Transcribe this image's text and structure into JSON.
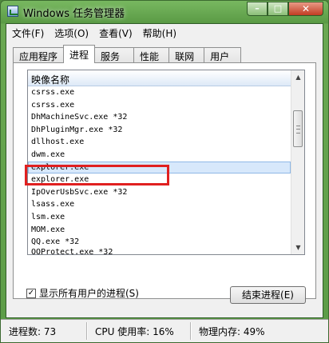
{
  "window": {
    "title": "Windows 任务管理器",
    "buttons": {
      "minimize": "–",
      "maximize": "□",
      "close": "✕"
    }
  },
  "menu": [
    "文件(F)",
    "选项(O)",
    "查看(V)",
    "帮助(H)"
  ],
  "tabs": [
    "应用程序",
    "进程",
    "服务",
    "性能",
    "联网",
    "用户"
  ],
  "active_tab": "进程",
  "process_list": {
    "column_header": "映像名称",
    "sort_indicator": "^",
    "rows": [
      "csrss.exe",
      "csrss.exe",
      "DhMachineSvc.exe *32",
      "DhPluginMgr.exe *32",
      "dllhost.exe",
      "dwm.exe",
      "explorer.exe",
      "explorer.exe",
      "IpOverUsbSvc.exe *32",
      "lsass.exe",
      "lsm.exe",
      "MOM.exe",
      "QQ.exe *32",
      "QQProtect.exe *32"
    ],
    "selected_row": "explorer.exe"
  },
  "show_all_users": {
    "label": "显示所有用户的进程(S)",
    "checked": true
  },
  "end_process_button": "结束进程(E)",
  "status": {
    "processes": "进程数: 73",
    "cpu": "CPU 使用率: 16%",
    "memory": "物理内存: 49%"
  },
  "icons": [
    "task-manager-icon",
    "minimize-icon",
    "maximize-icon",
    "close-icon",
    "checkbox-checked-icon",
    "scroll-up-icon",
    "scroll-down-icon"
  ]
}
